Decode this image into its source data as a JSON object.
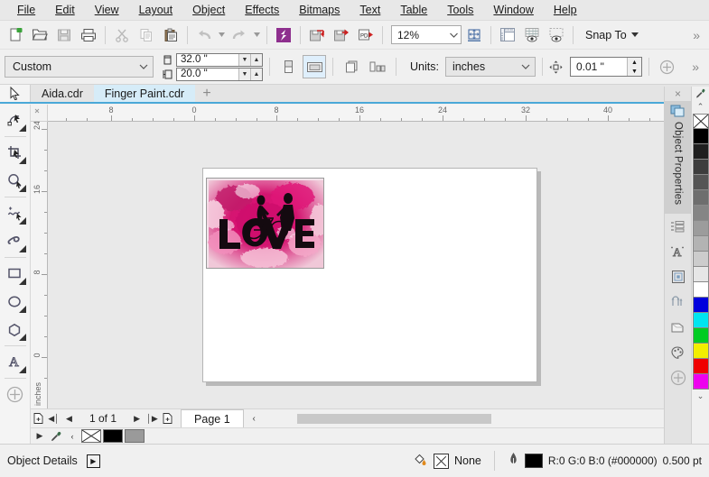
{
  "app": {
    "name": "CorelDRAW"
  },
  "menubar": {
    "items": [
      {
        "label": "File"
      },
      {
        "label": "Edit"
      },
      {
        "label": "View"
      },
      {
        "label": "Layout"
      },
      {
        "label": "Object"
      },
      {
        "label": "Effects"
      },
      {
        "label": "Bitmaps"
      },
      {
        "label": "Text"
      },
      {
        "label": "Table"
      },
      {
        "label": "Tools"
      },
      {
        "label": "Window"
      },
      {
        "label": "Help"
      }
    ]
  },
  "toolbar": {
    "buttons": [
      {
        "name": "new-document-icon",
        "title": "New"
      },
      {
        "name": "open-folder-icon",
        "title": "Open"
      },
      {
        "name": "save-icon",
        "title": "Save"
      },
      {
        "name": "print-icon",
        "title": "Print"
      },
      {
        "name": "cut-scissors-icon",
        "title": "Cut"
      },
      {
        "name": "copy-icon",
        "title": "Copy"
      },
      {
        "name": "paste-clipboard-icon",
        "title": "Paste"
      },
      {
        "name": "undo-arrow-icon",
        "title": "Undo"
      },
      {
        "name": "redo-arrow-icon",
        "title": "Redo"
      },
      {
        "name": "corel-connect-icon",
        "title": "Search Content"
      },
      {
        "name": "import-icon",
        "title": "Import"
      },
      {
        "name": "export-icon",
        "title": "Export"
      },
      {
        "name": "publish-pdf-icon",
        "title": "Export To PDF"
      }
    ],
    "zoom_level": "12%",
    "zoom_fit_icon": "zoom-to-fit-icon",
    "view_buttons": [
      {
        "name": "show-rulers-icon"
      },
      {
        "name": "show-grid-icon"
      },
      {
        "name": "show-guidelines-icon"
      }
    ],
    "snap_to_label": "Snap To",
    "overflow_label": "»"
  },
  "propertybar": {
    "page_size": "Custom",
    "width_value": "32.0 \"",
    "height_value": "20.0 \"",
    "orientation": [
      {
        "name": "portrait-button"
      },
      {
        "name": "landscape-button"
      }
    ],
    "page_buttons": [
      {
        "name": "all-pages-button"
      },
      {
        "name": "current-page-button"
      }
    ],
    "units_label": "Units:",
    "units_value": "inches",
    "nudge_value": "0.01 \"",
    "add-button": "⊕",
    "overflow_label": "»"
  },
  "tabbar": {
    "tabs": [
      {
        "label": "Aida.cdr",
        "active": false
      },
      {
        "label": "Finger Paint.cdr",
        "active": true
      }
    ],
    "add_tab_label": "+",
    "close_label": "×"
  },
  "toolbox": {
    "tools": [
      {
        "name": "shape-tool",
        "glyph": "shape"
      },
      {
        "name": "crop-tool",
        "glyph": "crop"
      },
      {
        "name": "zoom-tool",
        "glyph": "zoom"
      },
      {
        "name": "freehand-tool",
        "glyph": "freehand"
      },
      {
        "name": "artistic-media-tool",
        "glyph": "artistic"
      },
      {
        "name": "rectangle-tool",
        "glyph": "rectangle"
      },
      {
        "name": "ellipse-tool",
        "glyph": "ellipse"
      },
      {
        "name": "polygon-tool",
        "glyph": "polygon"
      },
      {
        "name": "text-tool",
        "glyph": "text"
      },
      {
        "name": "add-tool-button",
        "glyph": "plus"
      }
    ]
  },
  "rulers": {
    "horizontal_labels": [
      "8",
      "0",
      "8",
      "16",
      "24",
      "32",
      "40"
    ],
    "horizontal_unit": "inches",
    "vertical_labels": [
      "24",
      "16",
      "8",
      "0"
    ],
    "vertical_unit": "inches"
  },
  "canvas": {
    "artwork_title": "LOVE finger paint artwork",
    "artwork_text": "LOVE"
  },
  "navigator": {
    "add_page_start_icon": "add-page-icon",
    "first_label": "◀│",
    "prev_label": "◀",
    "page_count": "1 of 1",
    "next_label": "▶",
    "last_label": "│▶",
    "add_page_end_icon": "add-page-icon",
    "page_tab": "Page 1"
  },
  "docker": {
    "close_label": "×",
    "active_label": "Object Properties",
    "buttons": [
      {
        "name": "object-properties-icon"
      },
      {
        "name": "object-manager-icon"
      },
      {
        "name": "text-properties-icon"
      },
      {
        "name": "object-styles-icon"
      },
      {
        "name": "transformations-icon"
      },
      {
        "name": "effects-icon"
      },
      {
        "name": "color-styles-icon"
      },
      {
        "name": "add-docker-icon"
      }
    ]
  },
  "palette": {
    "eyedropper_icon": "eyedropper-icon",
    "scroll_up_label": "⌃",
    "scroll_down_label": "⌄",
    "swatches": [
      {
        "name": "no-color",
        "hex": "none"
      },
      {
        "name": "black",
        "hex": "#000000"
      },
      {
        "name": "gray-90",
        "hex": "#1f1f1f"
      },
      {
        "name": "gray-80",
        "hex": "#3d3d3d"
      },
      {
        "name": "gray-70",
        "hex": "#555555"
      },
      {
        "name": "gray-60",
        "hex": "#6e6e6e"
      },
      {
        "name": "gray-50",
        "hex": "#858585"
      },
      {
        "name": "gray-40",
        "hex": "#9c9c9c"
      },
      {
        "name": "gray-30",
        "hex": "#b3b3b3"
      },
      {
        "name": "gray-20",
        "hex": "#cccccc"
      },
      {
        "name": "gray-10",
        "hex": "#e6e6e6"
      },
      {
        "name": "white",
        "hex": "#ffffff"
      },
      {
        "name": "blue",
        "hex": "#0000dd"
      },
      {
        "name": "cyan",
        "hex": "#00e5f0"
      },
      {
        "name": "green",
        "hex": "#00cc22"
      },
      {
        "name": "yellow",
        "hex": "#f2ee00"
      },
      {
        "name": "red",
        "hex": "#f00000"
      },
      {
        "name": "magenta",
        "hex": "#ee00ee"
      }
    ]
  },
  "statusbar": {
    "object_details_label": "Object Details",
    "expand_label": "▶",
    "fill_label": "None",
    "outline_color_text": "R:0 G:0 B:0 (#000000)",
    "outline_width": "0.500 pt"
  },
  "palette_strip": {
    "play_label": "▶",
    "prev_label": "‹",
    "swatches": [
      {
        "name": "no-color-swatch",
        "hex": "none"
      },
      {
        "name": "black-swatch",
        "hex": "#000000"
      },
      {
        "name": "gray-swatch",
        "hex": "#999999"
      }
    ]
  }
}
